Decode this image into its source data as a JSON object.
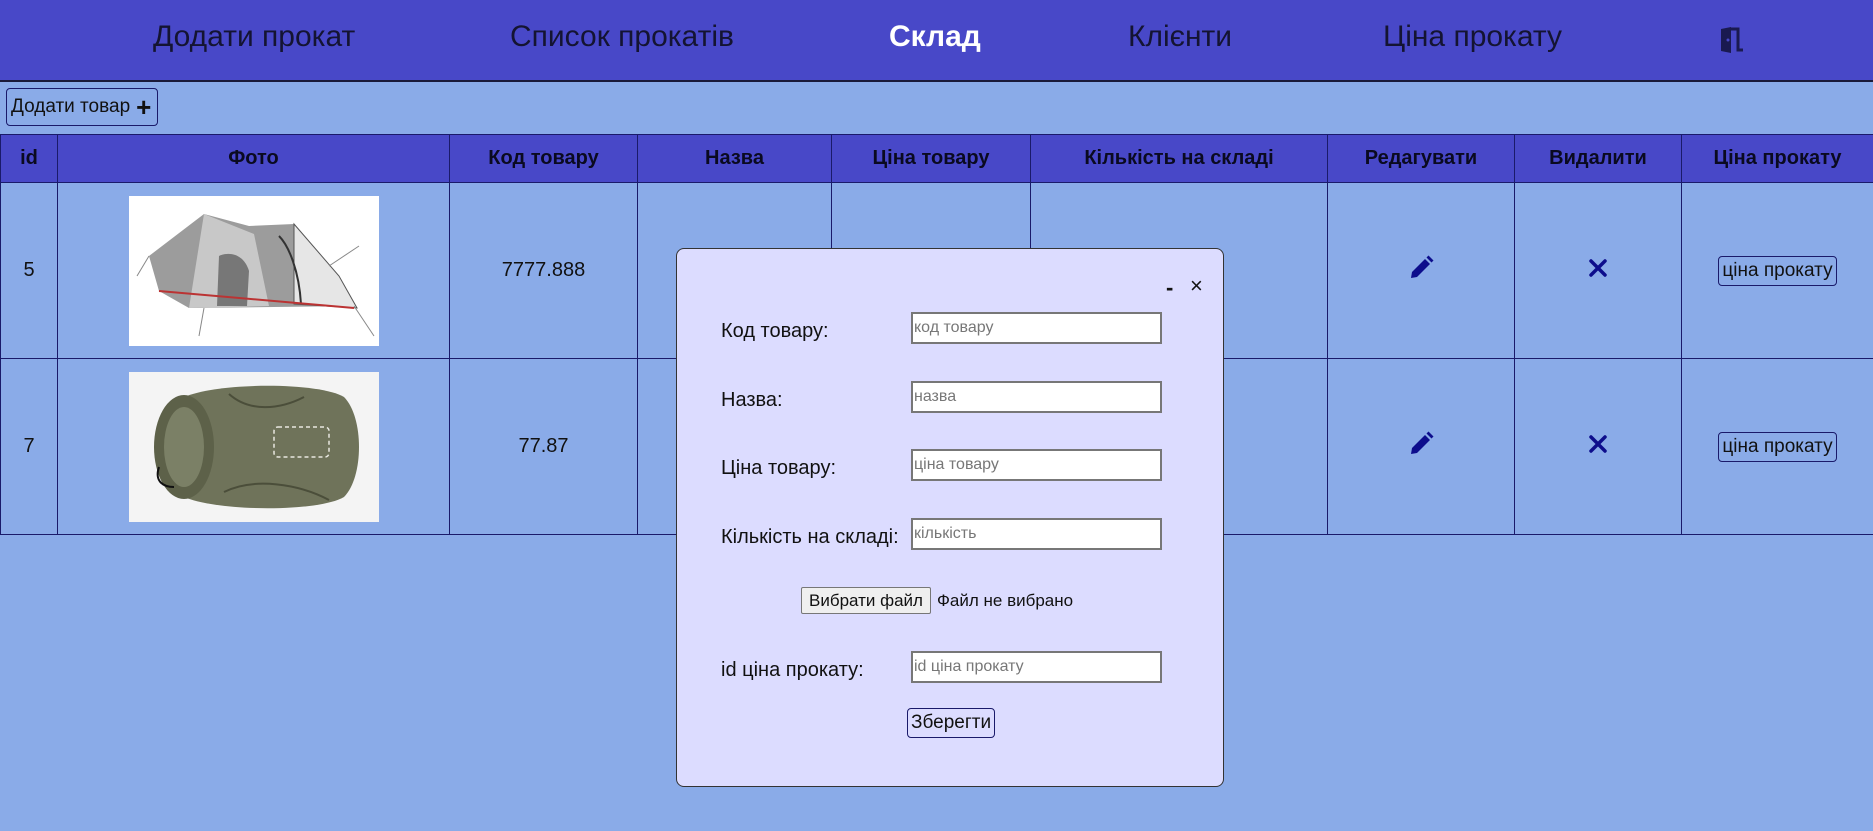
{
  "nav": {
    "items": [
      {
        "label": "Додати прокат"
      },
      {
        "label": "Список прокатів"
      },
      {
        "label": "Склад",
        "active": true
      },
      {
        "label": "Клієнти"
      },
      {
        "label": "Ціна прокату"
      }
    ],
    "logout_icon": "door-exit-icon"
  },
  "toolbar": {
    "add_label": "Додати товар",
    "add_icon": "plus-icon"
  },
  "table": {
    "columns": [
      "id",
      "Фото",
      "Код товару",
      "Назва",
      "Ціна товару",
      "Кількість на складі",
      "Редагувати",
      "Видалити",
      "Ціна прокату"
    ],
    "rows": [
      {
        "id": "5",
        "photo": "tent-image",
        "code": "7777.888",
        "name": "",
        "price": "",
        "quantity": "",
        "edit_icon": "pencil-icon",
        "delete_icon": "close-icon",
        "rent_price_label": "ціна прокату"
      },
      {
        "id": "7",
        "photo": "sleeping-bag-image",
        "code": "77.87",
        "name": "",
        "price": "",
        "quantity": "",
        "edit_icon": "pencil-icon",
        "delete_icon": "close-icon",
        "rent_price_label": "ціна прокату"
      }
    ]
  },
  "modal": {
    "minimize_label": "-",
    "close_label": "×",
    "fields": {
      "code": {
        "label": "Код товару:",
        "placeholder": "код товару",
        "value": ""
      },
      "name": {
        "label": "Назва:",
        "placeholder": "назва",
        "value": ""
      },
      "price": {
        "label": "Ціна товару:",
        "placeholder": "ціна товару",
        "value": ""
      },
      "quantity": {
        "label": "Кількість на складі:",
        "placeholder": "кількість",
        "value": ""
      },
      "rent_id": {
        "label": "id ціна прокату:",
        "placeholder": "id ціна прокату",
        "value": ""
      }
    },
    "file": {
      "button_label": "Вибрати файл",
      "status": "Файл не вибрано"
    },
    "save_label": "Зберегти"
  },
  "colors": {
    "page_bg": "#8aabe8",
    "nav_bg": "#4848c8",
    "modal_bg": "#dcdcff",
    "icon_color": "#0d0d8c"
  }
}
